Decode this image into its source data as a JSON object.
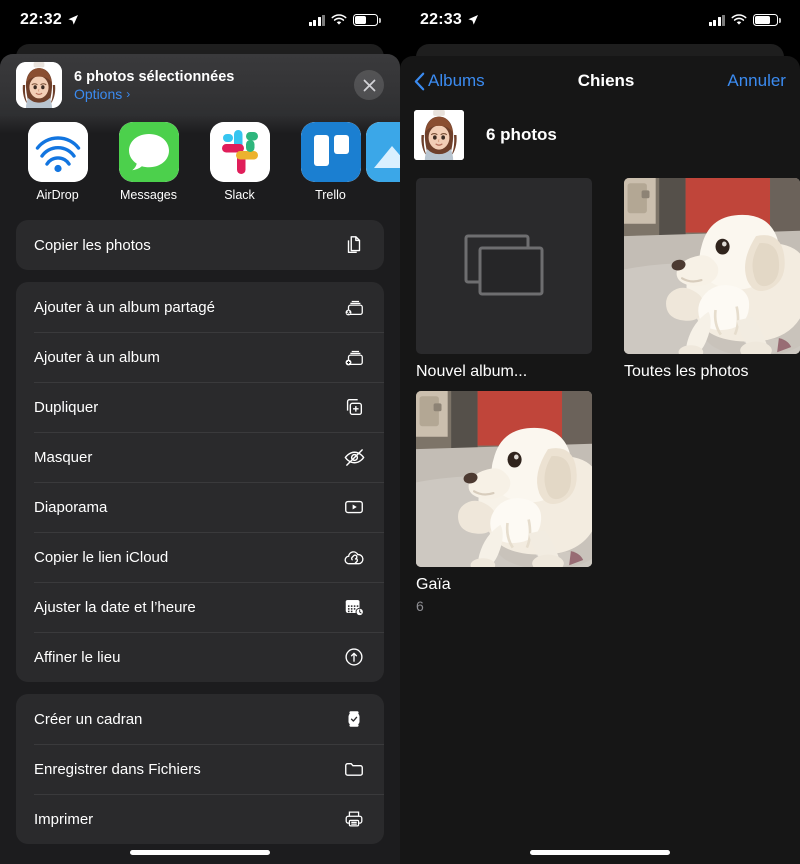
{
  "left_screen": {
    "status": {
      "time": "22:32",
      "location_icon": "location-arrow-icon",
      "signal_icon": "cellular-bars-icon",
      "wifi_icon": "wifi-icon",
      "battery_icon": "battery-icon",
      "battery_level": 55
    },
    "share_sheet": {
      "header": {
        "title": "6 photos sélectionnées",
        "options_label": "Options",
        "options_chevron": "›",
        "close_icon": "close-icon",
        "avatar": "memoji-avatar"
      },
      "apps": [
        {
          "label": "AirDrop",
          "icon": "airdrop-icon"
        },
        {
          "label": "Messages",
          "icon": "messages-icon"
        },
        {
          "label": "Slack",
          "icon": "slack-icon"
        },
        {
          "label": "Trello",
          "icon": "trello-icon"
        }
      ],
      "groups": [
        {
          "rows": [
            {
              "label": "Copier les photos",
              "icon": "copy-photos-icon"
            }
          ]
        },
        {
          "rows": [
            {
              "label": "Ajouter à un album partagé",
              "icon": "shared-album-icon"
            },
            {
              "label": "Ajouter à un album",
              "icon": "add-album-icon"
            },
            {
              "label": "Dupliquer",
              "icon": "duplicate-icon"
            },
            {
              "label": "Masquer",
              "icon": "eye-slash-icon"
            },
            {
              "label": "Diaporama",
              "icon": "slideshow-icon"
            },
            {
              "label": "Copier le lien iCloud",
              "icon": "icloud-link-icon"
            },
            {
              "label": "Ajuster la date et l’heure",
              "icon": "calendar-clock-icon"
            },
            {
              "label": "Affiner le lieu",
              "icon": "location-pin-icon"
            }
          ]
        },
        {
          "rows": [
            {
              "label": "Créer un cadran",
              "icon": "watch-face-icon"
            },
            {
              "label": "Enregistrer dans Fichiers",
              "icon": "folder-icon"
            },
            {
              "label": "Imprimer",
              "icon": "printer-icon"
            }
          ]
        }
      ]
    }
  },
  "right_screen": {
    "status": {
      "time": "22:33",
      "location_icon": "location-arrow-icon",
      "signal_icon": "cellular-bars-icon",
      "wifi_icon": "wifi-icon",
      "battery_icon": "battery-icon",
      "battery_level": 72
    },
    "picker": {
      "navbar": {
        "back_label": "Albums",
        "back_icon": "chevron-left-icon",
        "title": "Chiens",
        "cancel_label": "Annuler"
      },
      "selection": {
        "count_label": "6 photos",
        "thumb": "memoji-avatar"
      },
      "albums": [
        {
          "name": "Nouvel album...",
          "count": "",
          "thumb": "new-album-placeholder"
        },
        {
          "name": "Toutes les photos",
          "count": "",
          "thumb": "dog-photo"
        },
        {
          "name": "Gaïa",
          "count": "6",
          "thumb": "dog-photo"
        }
      ]
    }
  },
  "colors": {
    "accent_blue": "#3b8bf0",
    "sheet_bg": "#1c1c1e",
    "group_bg": "#2a2a2c",
    "picker_bg": "#161616",
    "secondary_text": "#8e8e93"
  }
}
